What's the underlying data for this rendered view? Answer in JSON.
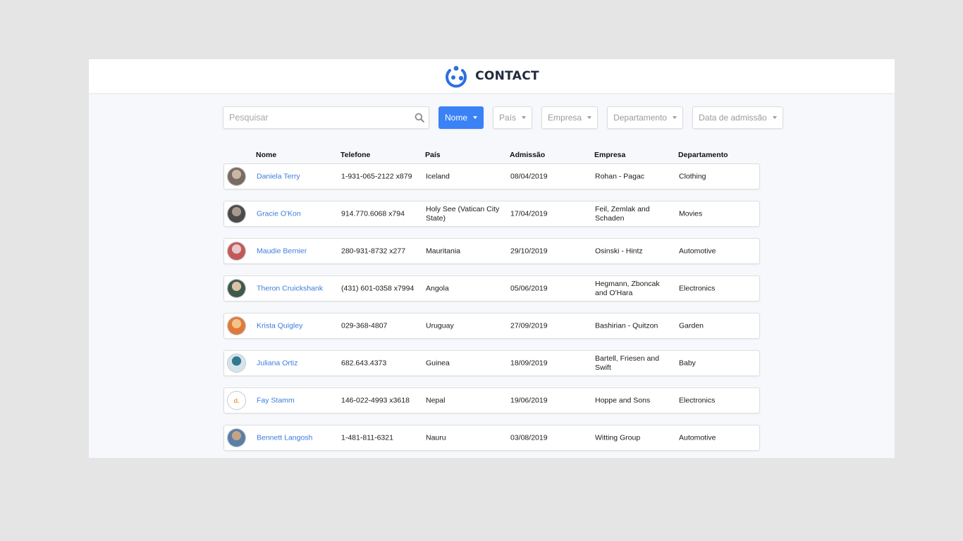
{
  "app": {
    "brand": "CONTACT"
  },
  "search": {
    "placeholder": "Pesquisar"
  },
  "filters": [
    {
      "label": "Nome",
      "active": true
    },
    {
      "label": "País",
      "active": false
    },
    {
      "label": "Empresa",
      "active": false
    },
    {
      "label": "Departamento",
      "active": false
    },
    {
      "label": "Data de admissão",
      "active": false
    }
  ],
  "columns": [
    "Nome",
    "Telefone",
    "País",
    "Admissão",
    "Empresa",
    "Departamento"
  ],
  "contacts": [
    {
      "name": "Daniela Terry",
      "phone": "1-931-065-2122 x879",
      "country": "Iceland",
      "admission": "08/04/2019",
      "company": "Rohan - Pagac",
      "department": "Clothing"
    },
    {
      "name": "Gracie O'Kon",
      "phone": "914.770.6068 x794",
      "country": "Holy See (Vatican City State)",
      "admission": "17/04/2019",
      "company": "Feil, Zemlak and Schaden",
      "department": "Movies"
    },
    {
      "name": "Maudie Bernier",
      "phone": "280-931-8732 x277",
      "country": "Mauritania",
      "admission": "29/10/2019",
      "company": "Osinski - Hintz",
      "department": "Automotive"
    },
    {
      "name": "Theron Cruickshank",
      "phone": "(431) 601-0358 x7994",
      "country": "Angola",
      "admission": "05/06/2019",
      "company": "Hegmann, Zboncak and O'Hara",
      "department": "Electronics"
    },
    {
      "name": "Krista Quigley",
      "phone": "029-368-4807",
      "country": "Uruguay",
      "admission": "27/09/2019",
      "company": "Bashirian - Quitzon",
      "department": "Garden"
    },
    {
      "name": "Juliana Ortiz",
      "phone": "682.643.4373",
      "country": "Guinea",
      "admission": "18/09/2019",
      "company": "Bartell, Friesen and Swift",
      "department": "Baby"
    },
    {
      "name": "Fay Stamm",
      "phone": "146-022-4993 x3618",
      "country": "Nepal",
      "admission": "19/06/2019",
      "company": "Hoppe and Sons",
      "department": "Electronics"
    },
    {
      "name": "Bennett Langosh",
      "phone": "1-481-811-6321",
      "country": "Nauru",
      "admission": "03/08/2019",
      "company": "Witting Group",
      "department": "Automotive"
    }
  ],
  "avatars": [
    {
      "icon": "avatar-photo",
      "colors": [
        "#7a6a62",
        "#c9b7a6"
      ]
    },
    {
      "icon": "avatar-photo",
      "colors": [
        "#4d4a4a",
        "#a7998e"
      ]
    },
    {
      "icon": "avatar-photo",
      "colors": [
        "#c25a5a",
        "#e7c9c9"
      ]
    },
    {
      "icon": "avatar-photo",
      "colors": [
        "#3f5a4a",
        "#d9c2a8"
      ]
    },
    {
      "icon": "avatar-photo",
      "colors": [
        "#e07a3a",
        "#f2c38a"
      ]
    },
    {
      "icon": "avatar-photo",
      "colors": [
        "#d5e3ea",
        "#2f7a8f"
      ]
    },
    {
      "icon": "avatar-letter",
      "letter": "d.",
      "colors": [
        "#ffffff",
        "#e8a23a"
      ]
    },
    {
      "icon": "avatar-photo",
      "colors": [
        "#5a7fa6",
        "#c6a384"
      ]
    }
  ],
  "colors": {
    "accent": "#3b82f6",
    "link": "#3b7ddd",
    "logo": "#2d6fe0"
  }
}
